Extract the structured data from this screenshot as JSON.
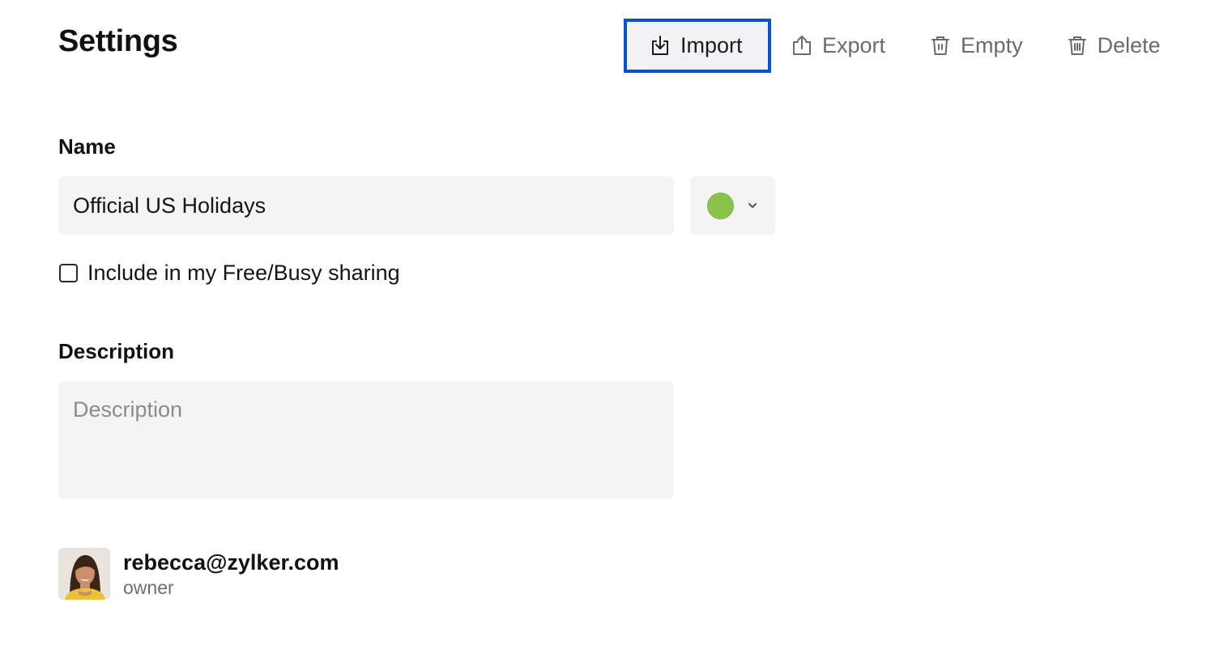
{
  "header": {
    "title": "Settings"
  },
  "toolbar": {
    "import_label": "Import",
    "export_label": "Export",
    "empty_label": "Empty",
    "delete_label": "Delete",
    "import_icon": "import-icon",
    "export_icon": "export-icon",
    "empty_icon": "trash-empty-icon",
    "delete_icon": "trash-delete-icon"
  },
  "form": {
    "name_label": "Name",
    "name_value": "Official US Holidays",
    "color_value": "#8bc34a",
    "free_busy_label": "Include in my Free/Busy sharing",
    "free_busy_checked": false,
    "description_label": "Description",
    "description_placeholder": "Description",
    "description_value": ""
  },
  "owner": {
    "email": "rebecca@zylker.com",
    "role": "owner"
  },
  "colors": {
    "accent_focus": "#0a52c9",
    "field_background": "#f4f4f4",
    "calendar_color": "#8bc34a"
  }
}
